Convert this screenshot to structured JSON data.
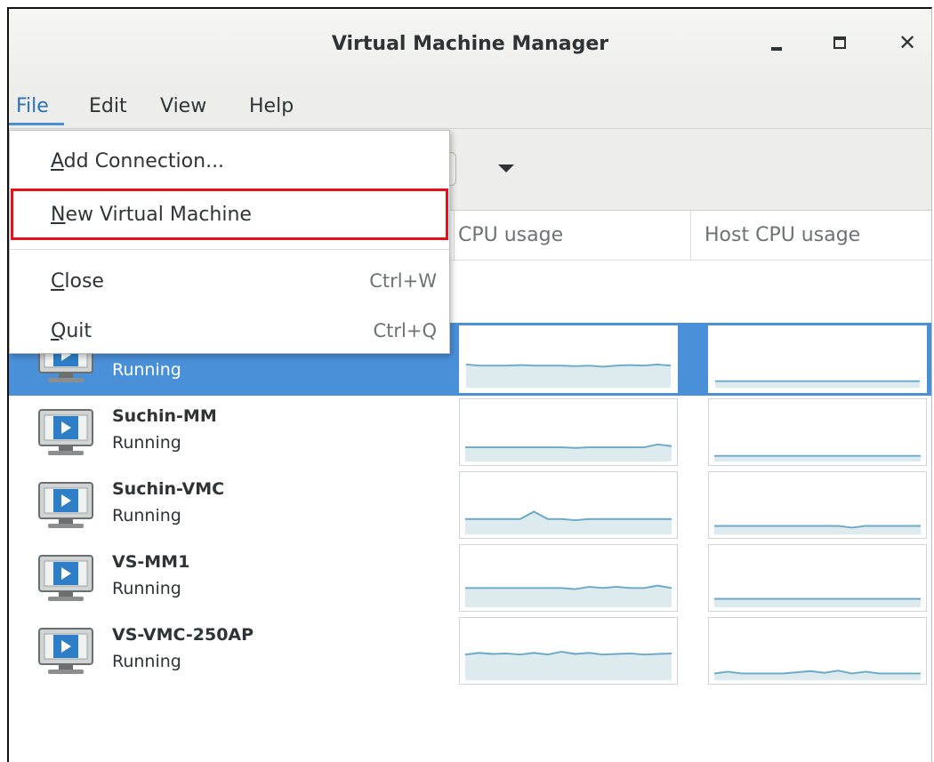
{
  "window": {
    "title": "Virtual Machine Manager",
    "controls": {
      "minimize": "minimize-icon",
      "maximize": "maximize-icon",
      "close": "close-icon"
    }
  },
  "menubar": {
    "file": "File",
    "edit": "Edit",
    "view": "View",
    "help": "Help"
  },
  "file_menu": {
    "items": [
      {
        "label_prefix": "",
        "mnemonic": "A",
        "label_rest": "dd Connection...",
        "accel": ""
      },
      {
        "label_prefix": "",
        "mnemonic": "N",
        "label_rest": "ew Virtual Machine",
        "accel": ""
      },
      {
        "label_prefix": "",
        "mnemonic": "C",
        "label_rest": "lose",
        "accel": "Ctrl+W"
      },
      {
        "label_prefix": "",
        "mnemonic": "Q",
        "label_rest": "uit",
        "accel": "Ctrl+Q"
      }
    ],
    "highlighted_item": "New Virtual Machine",
    "highlight_color": "#e8101a"
  },
  "columns": {
    "guest_cpu": "CPU usage",
    "host_cpu": "Host CPU usage"
  },
  "vms": [
    {
      "name": "",
      "status": "Running",
      "selected": true,
      "guest": [
        0.42,
        0.4,
        0.4,
        0.4,
        0.41,
        0.4,
        0.4,
        0.4,
        0.39,
        0.4,
        0.38,
        0.4,
        0.41,
        0.4,
        0.42,
        0.4
      ],
      "host": [
        0.12,
        0.12,
        0.12,
        0.12,
        0.12,
        0.12,
        0.12,
        0.12,
        0.12,
        0.12,
        0.12,
        0.12,
        0.12,
        0.12,
        0.12,
        0.12
      ]
    },
    {
      "name": "Suchin-MM",
      "status": "Running",
      "selected": false,
      "guest": [
        0.25,
        0.25,
        0.25,
        0.25,
        0.25,
        0.25,
        0.25,
        0.25,
        0.24,
        0.25,
        0.25,
        0.25,
        0.25,
        0.25,
        0.3,
        0.27
      ],
      "host": [
        0.1,
        0.1,
        0.1,
        0.1,
        0.1,
        0.1,
        0.1,
        0.1,
        0.1,
        0.1,
        0.1,
        0.1,
        0.1,
        0.1,
        0.1,
        0.1
      ]
    },
    {
      "name": "Suchin-VMC",
      "status": "Running",
      "selected": false,
      "guest": [
        0.27,
        0.27,
        0.27,
        0.27,
        0.27,
        0.4,
        0.27,
        0.27,
        0.25,
        0.27,
        0.27,
        0.27,
        0.27,
        0.27,
        0.27,
        0.27
      ],
      "host": [
        0.15,
        0.15,
        0.15,
        0.15,
        0.15,
        0.15,
        0.15,
        0.15,
        0.15,
        0.15,
        0.12,
        0.15,
        0.15,
        0.15,
        0.15,
        0.15
      ]
    },
    {
      "name": "VS-MM1",
      "status": "Running",
      "selected": false,
      "guest": [
        0.34,
        0.34,
        0.34,
        0.34,
        0.34,
        0.34,
        0.34,
        0.34,
        0.32,
        0.36,
        0.34,
        0.36,
        0.34,
        0.34,
        0.38,
        0.34
      ],
      "host": [
        0.15,
        0.15,
        0.15,
        0.15,
        0.15,
        0.15,
        0.15,
        0.15,
        0.15,
        0.15,
        0.15,
        0.15,
        0.15,
        0.15,
        0.15,
        0.15
      ]
    },
    {
      "name": "VS-VMC-250AP",
      "status": "Running",
      "selected": false,
      "guest": [
        0.45,
        0.48,
        0.46,
        0.47,
        0.45,
        0.48,
        0.45,
        0.5,
        0.46,
        0.48,
        0.45,
        0.46,
        0.47,
        0.45,
        0.46,
        0.47
      ],
      "host": [
        0.12,
        0.15,
        0.12,
        0.12,
        0.12,
        0.12,
        0.14,
        0.16,
        0.13,
        0.17,
        0.12,
        0.15,
        0.12,
        0.12,
        0.12,
        0.12
      ]
    }
  ],
  "colors": {
    "selection": "#4a90d9",
    "graph_line": "#6aa9c8",
    "graph_fill": "#ddebef",
    "menu_active": "#2f6fb3"
  }
}
